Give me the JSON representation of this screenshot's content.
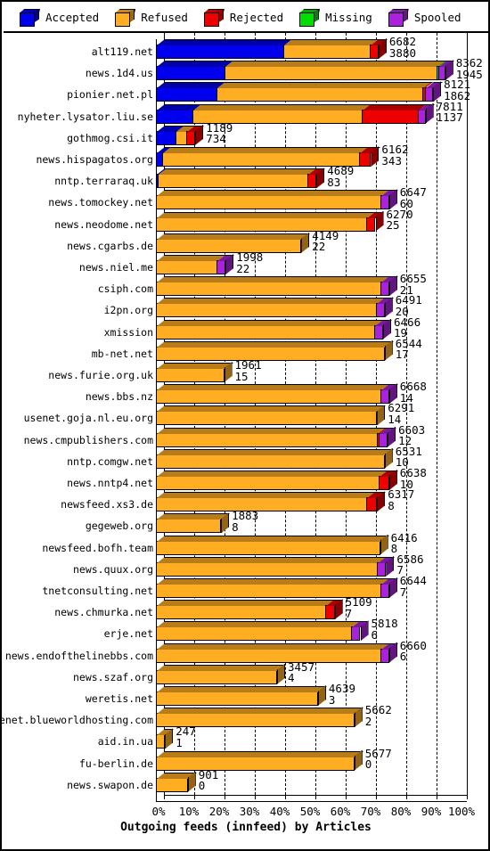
{
  "legend": {
    "items": [
      {
        "label": "Accepted",
        "color": "#0000ee",
        "name": "legend-accepted"
      },
      {
        "label": "Refused",
        "color": "#ffad22",
        "name": "legend-refused"
      },
      {
        "label": "Rejected",
        "color": "#ee0000",
        "name": "legend-rejected"
      },
      {
        "label": "Missing",
        "color": "#00dd00",
        "name": "legend-missing"
      },
      {
        "label": "Spooled",
        "color": "#aa22dd",
        "name": "legend-spooled"
      }
    ]
  },
  "chart_data": {
    "type": "bar",
    "orientation": "horizontal",
    "stacked": true,
    "title": "",
    "xlabel": "Outgoing feeds (innfeed) by Articles",
    "ylabel": "",
    "xlim": [
      0,
      100
    ],
    "xunit": "%",
    "grid": true,
    "legend_position": "top",
    "xticks": [
      "0%",
      "10%",
      "20%",
      "30%",
      "40%",
      "50%",
      "60%",
      "70%",
      "80%",
      "90%",
      "100%"
    ],
    "xtick_values": [
      0,
      10,
      20,
      30,
      40,
      50,
      60,
      70,
      80,
      90,
      100
    ],
    "series": [
      {
        "name": "Accepted",
        "color": "#0000ee"
      },
      {
        "name": "Refused",
        "color": "#ffad22"
      },
      {
        "name": "Rejected",
        "color": "#ee0000"
      },
      {
        "name": "Missing",
        "color": "#00dd00"
      },
      {
        "name": "Spooled",
        "color": "#aa22dd"
      }
    ],
    "categories": [
      "alt119.net",
      "news.1d4.us",
      "pionier.net.pl",
      "nyheter.lysator.liu.se",
      "gothmog.csi.it",
      "news.hispagatos.org",
      "nntp.terraraq.uk",
      "news.tomockey.net",
      "news.neodome.net",
      "news.cgarbs.de",
      "news.niel.me",
      "csiph.com",
      "i2pn.org",
      "xmission",
      "mb-net.net",
      "news.furie.org.uk",
      "news.bbs.nz",
      "usenet.goja.nl.eu.org",
      "news.cmpublishers.com",
      "nntp.comgw.net",
      "news.nntp4.net",
      "newsfeed.xs3.de",
      "gegeweb.org",
      "newsfeed.bofh.team",
      "news.quux.org",
      "tnetconsulting.net",
      "news.chmurka.net",
      "erje.net",
      "news.endofthelinebbs.com",
      "news.szaf.org",
      "weretis.net",
      "usenet.blueworldhosting.com",
      "aid.in.ua",
      "fu-berlin.de",
      "news.swapon.de"
    ],
    "rows": [
      {
        "label": "alt119.net",
        "total_pct": 73.5,
        "label_top": "6682",
        "label_bottom": "3880",
        "segments": [
          {
            "s": "Accepted",
            "pct": 42.0
          },
          {
            "s": "Refused",
            "pct": 28.5
          },
          {
            "s": "Rejected",
            "pct": 3.0
          }
        ]
      },
      {
        "label": "news.1d4.us",
        "total_pct": 95.5,
        "label_top": "8362",
        "label_bottom": "1945",
        "segments": [
          {
            "s": "Accepted",
            "pct": 22.5
          },
          {
            "s": "Refused",
            "pct": 70.0
          },
          {
            "s": "Missing",
            "pct": 0.6
          },
          {
            "s": "Spooled",
            "pct": 2.4
          }
        ]
      },
      {
        "label": "pionier.net.pl",
        "total_pct": 91.5,
        "label_top": "8121",
        "label_bottom": "1862",
        "segments": [
          {
            "s": "Accepted",
            "pct": 20.0
          },
          {
            "s": "Refused",
            "pct": 68.0
          },
          {
            "s": "Rejected",
            "pct": 0.7
          },
          {
            "s": "Spooled",
            "pct": 2.8
          }
        ]
      },
      {
        "label": "nyheter.lysator.liu.se",
        "total_pct": 89.0,
        "label_top": "7811",
        "label_bottom": "1137",
        "segments": [
          {
            "s": "Accepted",
            "pct": 12.0
          },
          {
            "s": "Refused",
            "pct": 56.0
          },
          {
            "s": "Rejected",
            "pct": 18.5
          },
          {
            "s": "Spooled",
            "pct": 2.5
          }
        ]
      },
      {
        "label": "gothmog.csi.it",
        "total_pct": 13.0,
        "label_top": "1189",
        "label_bottom": "734",
        "segments": [
          {
            "s": "Accepted",
            "pct": 6.5
          },
          {
            "s": "Refused",
            "pct": 3.5
          },
          {
            "s": "Rejected",
            "pct": 3.0
          }
        ]
      },
      {
        "label": "news.hispagatos.org",
        "total_pct": 71.0,
        "label_top": "6162",
        "label_bottom": "343",
        "segments": [
          {
            "s": "Accepted",
            "pct": 2.0
          },
          {
            "s": "Refused",
            "pct": 65.0
          },
          {
            "s": "Rejected",
            "pct": 4.0
          }
        ]
      },
      {
        "label": "nntp.terraraq.uk",
        "total_pct": 53.0,
        "label_top": "4689",
        "label_bottom": "83",
        "segments": [
          {
            "s": "Accepted",
            "pct": 0.6
          },
          {
            "s": "Refused",
            "pct": 49.5
          },
          {
            "s": "Rejected",
            "pct": 2.9
          }
        ]
      },
      {
        "label": "news.tomockey.net",
        "total_pct": 77.0,
        "label_top": "6647",
        "label_bottom": "60",
        "segments": [
          {
            "s": "Refused",
            "pct": 74.0
          },
          {
            "s": "Spooled",
            "pct": 3.0
          }
        ]
      },
      {
        "label": "news.neodome.net",
        "total_pct": 72.5,
        "label_top": "6270",
        "label_bottom": "25",
        "segments": [
          {
            "s": "Refused",
            "pct": 69.5
          },
          {
            "s": "Rejected",
            "pct": 3.0
          }
        ]
      },
      {
        "label": "news.cgarbs.de",
        "total_pct": 48.0,
        "label_top": "4149",
        "label_bottom": "22",
        "segments": [
          {
            "s": "Refused",
            "pct": 48.0
          }
        ]
      },
      {
        "label": "news.niel.me",
        "total_pct": 23.0,
        "label_top": "1998",
        "label_bottom": "22",
        "segments": [
          {
            "s": "Refused",
            "pct": 20.0
          },
          {
            "s": "Spooled",
            "pct": 3.0
          }
        ]
      },
      {
        "label": "csiph.com",
        "total_pct": 77.0,
        "label_top": "6655",
        "label_bottom": "21",
        "segments": [
          {
            "s": "Refused",
            "pct": 74.0
          },
          {
            "s": "Spooled",
            "pct": 3.0
          }
        ]
      },
      {
        "label": "i2pn.org",
        "total_pct": 75.5,
        "label_top": "6491",
        "label_bottom": "20",
        "segments": [
          {
            "s": "Refused",
            "pct": 72.5
          },
          {
            "s": "Spooled",
            "pct": 3.0
          }
        ]
      },
      {
        "label": "xmission",
        "total_pct": 75.0,
        "label_top": "6466",
        "label_bottom": "19",
        "segments": [
          {
            "s": "Refused",
            "pct": 72.0
          },
          {
            "s": "Spooled",
            "pct": 3.0
          }
        ]
      },
      {
        "label": "mb-net.net",
        "total_pct": 75.5,
        "label_top": "6544",
        "label_bottom": "17",
        "segments": [
          {
            "s": "Refused",
            "pct": 75.5
          }
        ]
      },
      {
        "label": "news.furie.org.uk",
        "total_pct": 22.5,
        "label_top": "1961",
        "label_bottom": "15",
        "segments": [
          {
            "s": "Refused",
            "pct": 22.5
          }
        ]
      },
      {
        "label": "news.bbs.nz",
        "total_pct": 77.0,
        "label_top": "6668",
        "label_bottom": "14",
        "segments": [
          {
            "s": "Refused",
            "pct": 74.0
          },
          {
            "s": "Spooled",
            "pct": 3.0
          }
        ]
      },
      {
        "label": "usenet.goja.nl.eu.org",
        "total_pct": 73.0,
        "label_top": "6291",
        "label_bottom": "14",
        "segments": [
          {
            "s": "Refused",
            "pct": 73.0
          }
        ]
      },
      {
        "label": "news.cmpublishers.com",
        "total_pct": 76.5,
        "label_top": "6603",
        "label_bottom": "12",
        "segments": [
          {
            "s": "Refused",
            "pct": 73.0
          },
          {
            "s": "Rejected",
            "pct": 0.5
          },
          {
            "s": "Spooled",
            "pct": 3.0
          }
        ]
      },
      {
        "label": "nntp.comgw.net",
        "total_pct": 75.5,
        "label_top": "6531",
        "label_bottom": "10",
        "segments": [
          {
            "s": "Refused",
            "pct": 75.5
          }
        ]
      },
      {
        "label": "news.nntp4.net",
        "total_pct": 77.0,
        "label_top": "6638",
        "label_bottom": "10",
        "segments": [
          {
            "s": "Refused",
            "pct": 73.5
          },
          {
            "s": "Rejected",
            "pct": 3.5
          }
        ]
      },
      {
        "label": "newsfeed.xs3.de",
        "total_pct": 73.0,
        "label_top": "6317",
        "label_bottom": "8",
        "segments": [
          {
            "s": "Refused",
            "pct": 69.5
          },
          {
            "s": "Rejected",
            "pct": 3.5
          }
        ]
      },
      {
        "label": "gegeweb.org",
        "total_pct": 21.5,
        "label_top": "1883",
        "label_bottom": "8",
        "segments": [
          {
            "s": "Refused",
            "pct": 21.5
          }
        ]
      },
      {
        "label": "newsfeed.bofh.team",
        "total_pct": 74.0,
        "label_top": "6416",
        "label_bottom": "8",
        "segments": [
          {
            "s": "Refused",
            "pct": 74.0
          }
        ]
      },
      {
        "label": "news.quux.org",
        "total_pct": 76.0,
        "label_top": "6586",
        "label_bottom": "7",
        "segments": [
          {
            "s": "Refused",
            "pct": 73.0
          },
          {
            "s": "Spooled",
            "pct": 3.0
          }
        ]
      },
      {
        "label": "tnetconsulting.net",
        "total_pct": 77.0,
        "label_top": "6644",
        "label_bottom": "7",
        "segments": [
          {
            "s": "Refused",
            "pct": 74.0
          },
          {
            "s": "Spooled",
            "pct": 3.0
          }
        ]
      },
      {
        "label": "news.chmurka.net",
        "total_pct": 59.0,
        "label_top": "5109",
        "label_bottom": "7",
        "segments": [
          {
            "s": "Refused",
            "pct": 56.0
          },
          {
            "s": "Rejected",
            "pct": 3.0
          }
        ]
      },
      {
        "label": "erje.net",
        "total_pct": 67.5,
        "label_top": "5818",
        "label_bottom": "6",
        "segments": [
          {
            "s": "Refused",
            "pct": 64.5
          },
          {
            "s": "Spooled",
            "pct": 3.0
          }
        ]
      },
      {
        "label": "news.endofthelinebbs.com",
        "total_pct": 77.0,
        "label_top": "6660",
        "label_bottom": "6",
        "segments": [
          {
            "s": "Refused",
            "pct": 74.0
          },
          {
            "s": "Spooled",
            "pct": 3.0
          }
        ]
      },
      {
        "label": "news.szaf.org",
        "total_pct": 40.0,
        "label_top": "3457",
        "label_bottom": "4",
        "segments": [
          {
            "s": "Refused",
            "pct": 40.0
          }
        ]
      },
      {
        "label": "weretis.net",
        "total_pct": 53.5,
        "label_top": "4639",
        "label_bottom": "3",
        "segments": [
          {
            "s": "Refused",
            "pct": 53.5
          }
        ]
      },
      {
        "label": "usenet.blueworldhosting.com",
        "total_pct": 65.5,
        "label_top": "5662",
        "label_bottom": "2",
        "segments": [
          {
            "s": "Refused",
            "pct": 65.5
          }
        ]
      },
      {
        "label": "aid.in.ua",
        "total_pct": 3.0,
        "label_top": "247",
        "label_bottom": "1",
        "segments": [
          {
            "s": "Refused",
            "pct": 3.0
          }
        ]
      },
      {
        "label": "fu-berlin.de",
        "total_pct": 65.5,
        "label_top": "5677",
        "label_bottom": "0",
        "segments": [
          {
            "s": "Refused",
            "pct": 65.5
          }
        ]
      },
      {
        "label": "news.swapon.de",
        "total_pct": 10.5,
        "label_top": "901",
        "label_bottom": "0",
        "segments": [
          {
            "s": "Refused",
            "pct": 10.5
          }
        ]
      }
    ]
  }
}
